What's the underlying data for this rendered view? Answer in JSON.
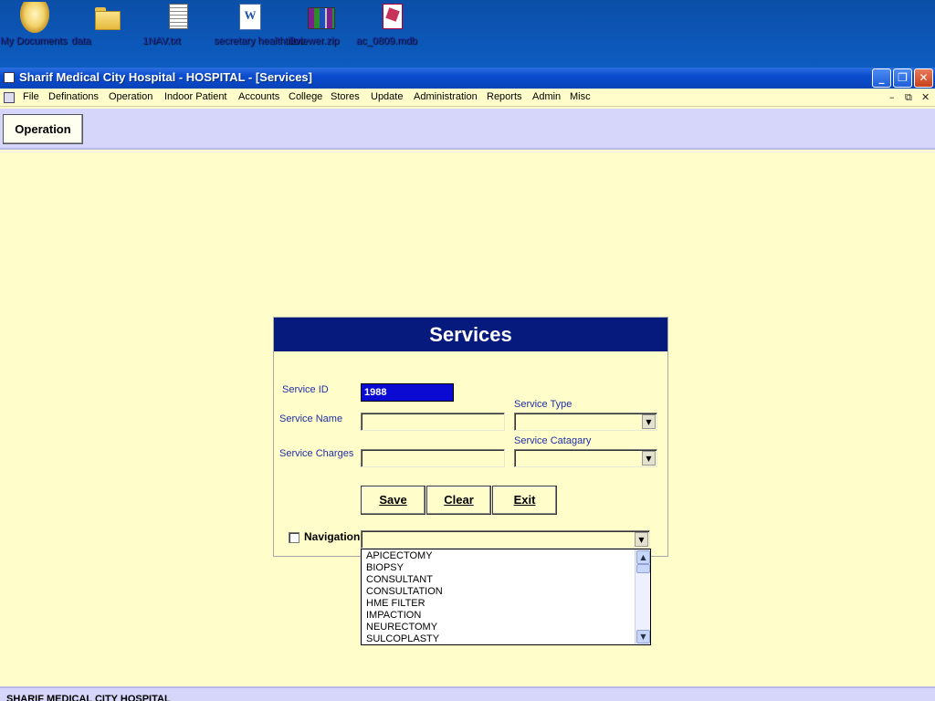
{
  "desktop": {
    "icons": [
      {
        "label": "My Documents",
        "icon": "my-documents-icon"
      },
      {
        "label": "data",
        "icon": "folder-icon"
      },
      {
        "label": "1NAV.txt",
        "icon": "text-file-icon"
      },
      {
        "label": "secretary health.doc",
        "icon": "word-document-icon"
      },
      {
        "label": "tiltviewer.zip",
        "icon": "zip-archive-icon"
      },
      {
        "label": "ac_0809.mdb",
        "icon": "access-database-icon"
      }
    ]
  },
  "window": {
    "title": "Sharif Medical City Hospital - HOSPITAL - [Services]",
    "caption_buttons": {
      "minimize": "_",
      "restore": "❐",
      "close": "✕"
    }
  },
  "menu": {
    "items": [
      "File",
      "Definations",
      "Operation",
      "Indoor Patient",
      "Accounts",
      "College",
      "Stores",
      "Update",
      "Administration",
      "Reports",
      "Admin",
      "Misc"
    ],
    "mdi_buttons": {
      "minimize": "–",
      "restore": "⧉",
      "close": "✕"
    }
  },
  "toolbar": {
    "operation_label": "Operation"
  },
  "form": {
    "title": "Services",
    "service_id_label": "Service ID",
    "service_id_value": "1988",
    "service_name_label": "Service Name",
    "service_name_value": "",
    "service_charges_label": "Service Charges",
    "service_charges_value": "",
    "service_type_label": "Service Type",
    "service_type_value": "",
    "service_category_label": "Service Catagary",
    "service_category_value": "",
    "buttons": {
      "save": "Save",
      "clear": "Clear",
      "exit": "Exit"
    },
    "navigation_label": "Navigation",
    "navigation_checked": false,
    "navigation_value": ""
  },
  "dropdown": {
    "options": [
      "APICECTOMY",
      "BIOPSY",
      "CONSULTANT",
      "CONSULTATION",
      "HME FILTER",
      "IMPACTION",
      "NEURECTOMY",
      "SULCOPLASTY"
    ]
  },
  "status": {
    "text": "SHARIF MEDICAL CITY HOSPITAL"
  },
  "colors": {
    "form_header": "#061a7e",
    "background": "#fffdc9",
    "toolbar": "#d6d6fa",
    "id_field": "#0a0ad2",
    "label_text": "#1f2fa6"
  }
}
